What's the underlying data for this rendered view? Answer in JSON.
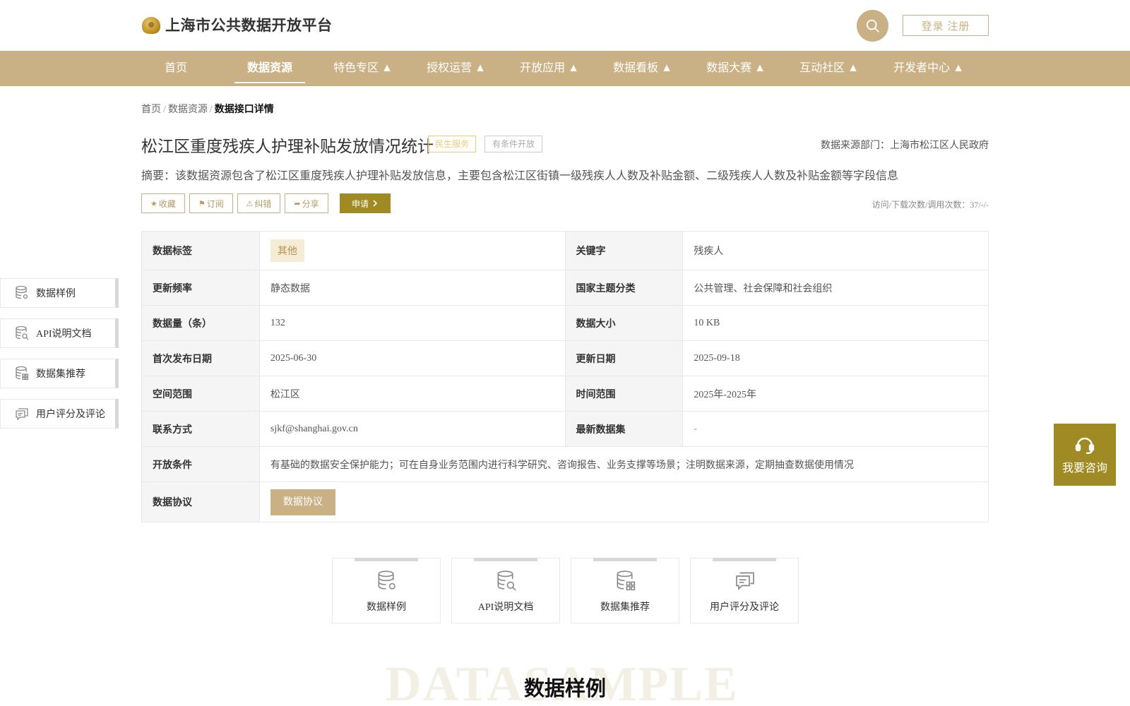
{
  "header": {
    "site_title": "上海市公共数据开放平台",
    "login_label": "登录 注册"
  },
  "nav": {
    "items": [
      {
        "label": "首页"
      },
      {
        "label": "数据资源"
      },
      {
        "label": "特色专区 ▲"
      },
      {
        "label": "授权运营 ▲"
      },
      {
        "label": "开放应用 ▲"
      },
      {
        "label": "数据看板 ▲"
      },
      {
        "label": "数据大赛 ▲"
      },
      {
        "label": "互动社区 ▲"
      },
      {
        "label": "开发者中心 ▲"
      }
    ],
    "active": "数据资源"
  },
  "breadcrumb": {
    "home": "首页",
    "level2": "数据资源",
    "current": "数据接口详情",
    "sep": "/"
  },
  "dataset": {
    "title": "松江区重度残疾人护理补贴发放情况统计",
    "tag_category": "民生服务",
    "tag_open": "有条件开放",
    "source": "数据来源部门：上海市松江区人民政府",
    "summary": "摘要：该数据资源包含了松江区重度残疾人护理补贴发放信息，主要包含松江区街镇一级残疾人人数及补贴金额、二级残疾人人数及补贴金额等字段信息",
    "stats": "访问/下载次数/调用次数：37/-/-"
  },
  "actions": {
    "favorite": "收藏",
    "subscribe": "订阅",
    "report": "纠错",
    "share": "分享",
    "apply": "申请"
  },
  "info": {
    "label_tags": "数据标签",
    "value_tags": "其他",
    "label_keywords": "关键字",
    "value_keywords": "残疾人",
    "label_freq": "更新频率",
    "value_freq": "静态数据",
    "label_theme": "国家主题分类",
    "value_theme": "公共管理、社会保障和社会组织",
    "label_count": "数据量（条）",
    "value_count": "132",
    "label_size": "数据大小",
    "value_size": "10 KB",
    "label_first": "首次发布日期",
    "value_first": "2025-06-30",
    "label_updated": "更新日期",
    "value_updated": "2025-09-18",
    "label_space": "空间范围",
    "value_space": "松江区",
    "label_time": "时间范围",
    "value_time": "2025年-2025年",
    "label_contact": "联系方式",
    "value_contact": "sjkf@shanghai.gov.cn",
    "label_latest": "最新数据集",
    "value_latest": "-",
    "label_conditions": "开放条件",
    "value_conditions": "有基础的数据安全保护能力；可在自身业务范围内进行科学研究、咨询报告、业务支撑等场景；注明数据来源，定期抽查数据使用情况",
    "label_agreement": "数据协议",
    "agreement_button": "数据协议"
  },
  "side_nav": {
    "sample": "数据样例",
    "api": "API说明文档",
    "recommend": "数据集推荐",
    "review": "用户评分及评论"
  },
  "cards": {
    "sample": "数据样例",
    "api": "API说明文档",
    "recommend": "数据集推荐",
    "review": "用户评分及评论"
  },
  "consult": {
    "label": "我要咨询"
  },
  "section": {
    "watermark": "DATASAMPLE",
    "title": "数据样例"
  },
  "colors": {
    "brand": "#c9b185",
    "accent": "#a08a23",
    "tag_yellow": "#f0c97a"
  }
}
